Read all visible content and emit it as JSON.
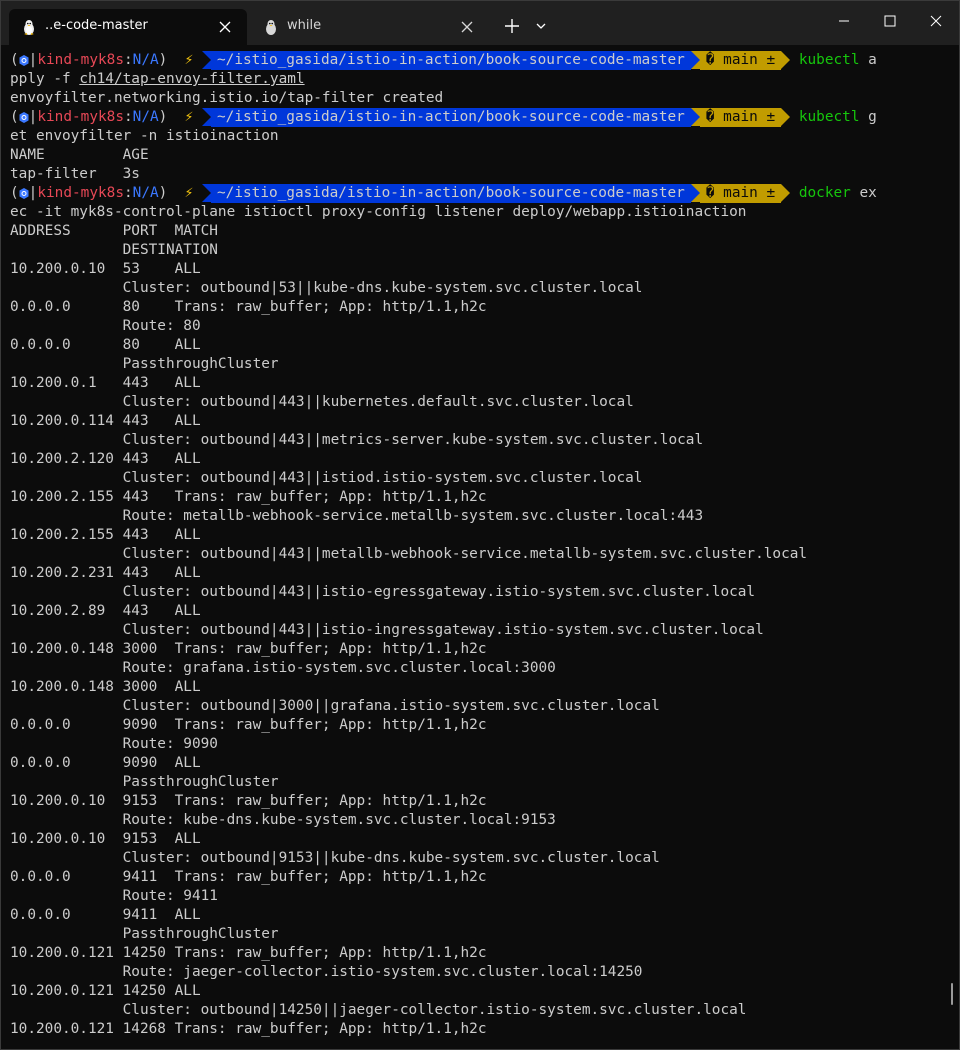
{
  "tabs": [
    {
      "title": "..e-code-master",
      "icon": "linux-tux-icon",
      "active": true
    },
    {
      "title": "while",
      "icon": "linux-tux-icon",
      "active": false
    }
  ],
  "window_controls": {
    "minimize": "minimize-icon",
    "maximize": "maximize-icon",
    "close": "close-icon"
  },
  "prompt": {
    "open_paren": "(",
    "context": "kind-myk8s",
    "sep": ":",
    "namespace": "N/A",
    "close_paren": ")",
    "bolt": "⚡",
    "path": "~/istio_gasida/istio-in-action/book-source-code-master",
    "branch": "� main ±"
  },
  "commands": [
    {
      "cmd": "kubectl",
      "rest_first": " a",
      "cont": "pply -f ",
      "arg_underlined": "ch14/tap-envoy-filter.yaml"
    },
    {
      "cmd": "kubectl",
      "rest_first": " g",
      "cont": "et envoyfilter -n istioinaction"
    },
    {
      "cmd": "docker",
      "rest_first": " ex",
      "cont": "ec -it myk8s-control-plane istioctl proxy-config listener deploy/webapp.istioinaction"
    }
  ],
  "output_apply": "envoyfilter.networking.istio.io/tap-filter created",
  "output_get": [
    "NAME         AGE",
    "tap-filter   3s"
  ],
  "listener_output": [
    "ADDRESS      PORT  MATCH",
    "             DESTINATION",
    "10.200.0.10  53    ALL",
    "             Cluster: outbound|53||kube-dns.kube-system.svc.cluster.local",
    "0.0.0.0      80    Trans: raw_buffer; App: http/1.1,h2c",
    "             Route: 80",
    "0.0.0.0      80    ALL",
    "             PassthroughCluster",
    "10.200.0.1   443   ALL",
    "             Cluster: outbound|443||kubernetes.default.svc.cluster.local",
    "10.200.0.114 443   ALL",
    "             Cluster: outbound|443||metrics-server.kube-system.svc.cluster.local",
    "10.200.2.120 443   ALL",
    "             Cluster: outbound|443||istiod.istio-system.svc.cluster.local",
    "10.200.2.155 443   Trans: raw_buffer; App: http/1.1,h2c",
    "             Route: metallb-webhook-service.metallb-system.svc.cluster.local:443",
    "10.200.2.155 443   ALL",
    "             Cluster: outbound|443||metallb-webhook-service.metallb-system.svc.cluster.local",
    "10.200.2.231 443   ALL",
    "             Cluster: outbound|443||istio-egressgateway.istio-system.svc.cluster.local",
    "10.200.2.89  443   ALL",
    "             Cluster: outbound|443||istio-ingressgateway.istio-system.svc.cluster.local",
    "10.200.0.148 3000  Trans: raw_buffer; App: http/1.1,h2c",
    "             Route: grafana.istio-system.svc.cluster.local:3000",
    "10.200.0.148 3000  ALL",
    "             Cluster: outbound|3000||grafana.istio-system.svc.cluster.local",
    "0.0.0.0      9090  Trans: raw_buffer; App: http/1.1,h2c",
    "             Route: 9090",
    "0.0.0.0      9090  ALL",
    "             PassthroughCluster",
    "10.200.0.10  9153  Trans: raw_buffer; App: http/1.1,h2c",
    "             Route: kube-dns.kube-system.svc.cluster.local:9153",
    "10.200.0.10  9153  ALL",
    "             Cluster: outbound|9153||kube-dns.kube-system.svc.cluster.local",
    "0.0.0.0      9411  Trans: raw_buffer; App: http/1.1,h2c",
    "             Route: 9411",
    "0.0.0.0      9411  ALL",
    "             PassthroughCluster",
    "10.200.0.121 14250 Trans: raw_buffer; App: http/1.1,h2c",
    "             Route: jaeger-collector.istio-system.svc.cluster.local:14250",
    "10.200.0.121 14250 ALL",
    "             Cluster: outbound|14250||jaeger-collector.istio-system.svc.cluster.local",
    "10.200.0.121 14268 Trans: raw_buffer; App: http/1.1,h2c"
  ],
  "colors": {
    "background": "#0c0c0c",
    "titlebar": "#202020",
    "foreground": "#cccccc",
    "context_red": "#e74856",
    "path_bg": "#0037da",
    "git_bg": "#c19c00",
    "command_green": "#16c60c"
  }
}
